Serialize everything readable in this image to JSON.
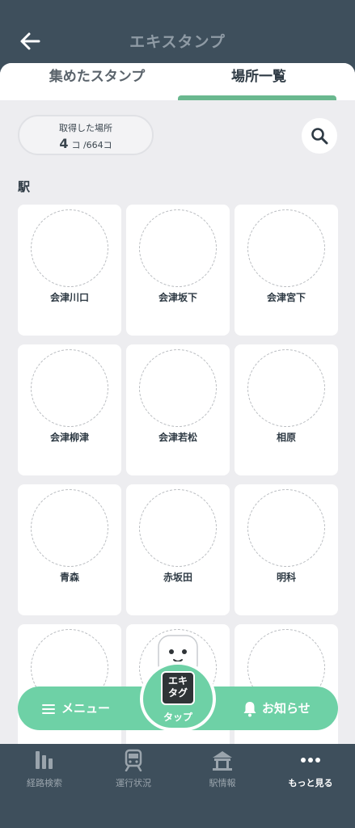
{
  "header": {
    "title": "エキスタンプ",
    "back_icon": "arrow-left-icon"
  },
  "tabs": [
    {
      "label": "集めたスタンプ",
      "active": false
    },
    {
      "label": "場所一覧",
      "active": true
    }
  ],
  "colors": {
    "accent": "#6ed1a6",
    "header_bg": "#3e4f5c",
    "tab_underline": "#6ab88f"
  },
  "summary": {
    "label": "取得した場所",
    "count": "4",
    "count_unit": "コ",
    "total": "/664コ"
  },
  "search": {
    "icon": "search-icon"
  },
  "section": {
    "title": "駅"
  },
  "stations": [
    "会津川口",
    "会津坂下",
    "会津宮下",
    "会津柳津",
    "会津若松",
    "相原",
    "青森",
    "赤坂田",
    "明科",
    "",
    "",
    ""
  ],
  "action_bar": {
    "menu_label": "メニュー",
    "center_label": "タップ",
    "logo_text_line1": "エキ",
    "logo_text_line2": "タグ",
    "notice_label": "お知らせ"
  },
  "bottom_nav": [
    {
      "label": "経路検索",
      "icon": "route-icon",
      "active": false
    },
    {
      "label": "運行状況",
      "icon": "train-icon",
      "active": false
    },
    {
      "label": "駅情報",
      "icon": "station-icon",
      "active": false
    },
    {
      "label": "もっと見る",
      "icon": "more-icon",
      "active": true
    }
  ]
}
